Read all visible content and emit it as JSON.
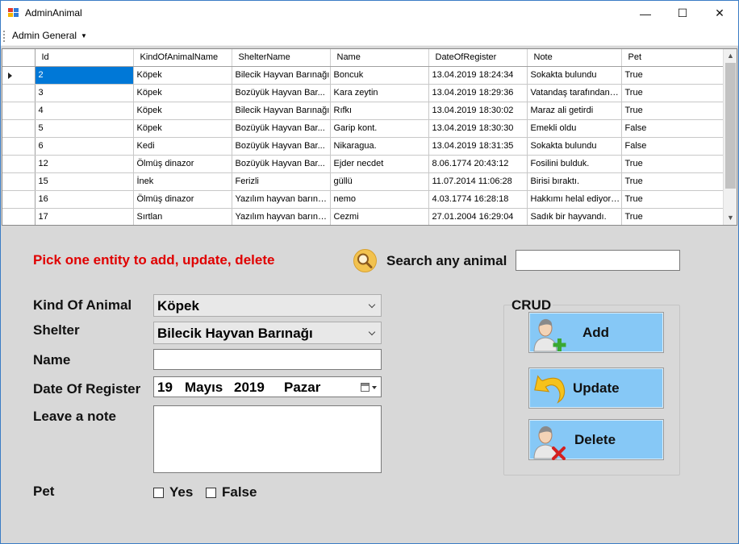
{
  "window": {
    "title": "AdminAnimal",
    "minimize": "—",
    "maximize": "☐",
    "close": "✕"
  },
  "menu": {
    "admin_general": "Admin General"
  },
  "grid": {
    "columns": [
      "Id",
      "KindOfAnimalName",
      "ShelterName",
      "Name",
      "DateOfRegister",
      "Note",
      "Pet"
    ],
    "rows": [
      [
        "2",
        "Köpek",
        "Bilecik Hayvan Barınağı",
        "Boncuk",
        "13.04.2019 18:24:34",
        "Sokakta bulundu",
        "True"
      ],
      [
        "3",
        "Köpek",
        "Bozüyük Hayvan Bar...",
        "Kara zeytin",
        "13.04.2019 18:29:36",
        "Vatandaş tarafından b...",
        "True"
      ],
      [
        "4",
        "Köpek",
        "Bilecik Hayvan Barınağı",
        "Rıfkı",
        "13.04.2019 18:30:02",
        "Maraz ali getirdi",
        "True"
      ],
      [
        "5",
        "Köpek",
        "Bozüyük Hayvan Bar...",
        "Garip kont.",
        "13.04.2019 18:30:30",
        "Emekli oldu",
        "False"
      ],
      [
        "6",
        "Kedi",
        "Bozüyük Hayvan Bar...",
        "Nikaragua.",
        "13.04.2019 18:31:35",
        "Sokakta bulundu",
        "False"
      ],
      [
        "12",
        "Ölmüş dinazor",
        "Bozüyük Hayvan Bar...",
        "Ejder necdet",
        "8.06.1774 20:43:12",
        "Fosilini bulduk.",
        "True"
      ],
      [
        "15",
        "İnek",
        "Ferizli",
        "güllü",
        "11.07.2014 11:06:28",
        "Birisi bıraktı.",
        "True"
      ],
      [
        "16",
        "Ölmüş dinazor",
        "Yazılım hayvan barınağı",
        "nemo",
        "4.03.1774 16:28:18",
        "Hakkımı helal ediyorum",
        "True"
      ],
      [
        "17",
        "Sırtlan",
        "Yazılım hayvan barınağı",
        "Cezmi",
        "27.01.2004 16:29:04",
        "Sadık bir hayvandı.",
        "True"
      ]
    ]
  },
  "form": {
    "pick_label": "Pick one entity to add, update, delete",
    "search_label": "Search any animal",
    "search_value": "",
    "kind_label": "Kind Of Animal",
    "kind_value": "Köpek",
    "shelter_label": "Shelter",
    "shelter_value": "Bilecik Hayvan Barınağı",
    "name_label": "Name",
    "name_value": "",
    "date_label": "Date Of Register",
    "date_day": "19",
    "date_month": "Mayıs",
    "date_year": "2019",
    "date_weekday": "Pazar",
    "note_label": "Leave a note",
    "note_value": "",
    "pet_label": "Pet",
    "yes_label": "Yes",
    "false_label": "False"
  },
  "crud": {
    "title": "CRUD",
    "add": "Add",
    "update": "Update",
    "delete": "Delete"
  },
  "colors": {
    "error_text": "#e00000",
    "selection": "#0078d7",
    "crud_button": "#86c8f6"
  }
}
